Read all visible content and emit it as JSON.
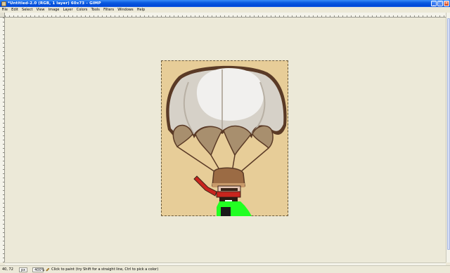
{
  "window": {
    "title": "*Untitled-2.0 (RGB, 1 layer) 60x73 – GIMP",
    "buttons": {
      "minimize": "_",
      "maximize": "□",
      "close": "×"
    }
  },
  "menu": [
    "File",
    "Edit",
    "Select",
    "View",
    "Image",
    "Layer",
    "Colors",
    "Tools",
    "Filters",
    "Windows",
    "Help"
  ],
  "colors": {
    "canvas_bg": "#e7cd98",
    "canopy_light": "#f1f0ee",
    "canopy_mid": "#d6d1c8",
    "canopy_brown": "#a88f6e",
    "outline": "#5a3a26",
    "hat": "#9b6b44",
    "scarf": "#c8251e",
    "green_layer": "#22ff22"
  },
  "status": {
    "coords": "40, 72",
    "unit": "px",
    "zoom": "400%",
    "message": "Click to paint (try Shift for a straight line, Ctrl to pick a color)"
  }
}
